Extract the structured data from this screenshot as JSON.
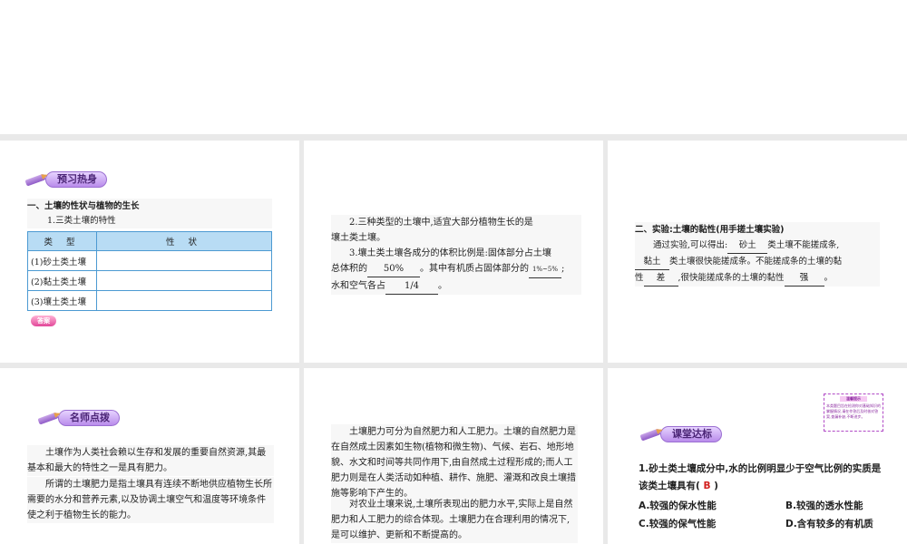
{
  "panel1": {
    "badge": "预习热身",
    "heading": "一、土壤的性状与植物的生长",
    "subheading": "1.三类土壤的特性",
    "table": {
      "headers": [
        "类 型",
        "性 状"
      ],
      "rows": [
        [
          "(1)砂土类土壤",
          ""
        ],
        [
          "(2)黏土类土壤",
          ""
        ],
        [
          "(3)壤土类土壤",
          ""
        ]
      ]
    },
    "answer_button": "答案"
  },
  "panel2": {
    "q2_line1": "2.三种类型的土壤中,适宜大部分植物生长的是",
    "q2_answer": "壤土类土壤",
    "q2_end": "。",
    "q3_line1": "3.壤土类土壤各成分的体积比例是:固体部分占土壤",
    "q3_pre": "总体积的",
    "q3_blank1": "50%",
    "q3_mid": "。其中有机质占固体部分的",
    "q3_blank2": "1%~5%",
    "q3_semicolon": ";",
    "q3_pre2": "水和空气各占",
    "q3_blank3": "1/4",
    "q3_end": "。"
  },
  "panel3": {
    "heading": "二、实验:土壤的黏性(用手搓土壤实验)",
    "s1": "通过实验,可以得出:",
    "b1": "砂土",
    "s2": "类土壤不能搓成条,",
    "b2": "黏土",
    "s3": "类土壤很快能搓成条。不能搓成条的土壤的黏",
    "s4": "性",
    "b3": "差",
    "s5": ",很快能搓成条的土壤的黏性",
    "b4": "强",
    "s6": "。"
  },
  "panel4": {
    "badge": "名师点拨",
    "p1": "土壤作为人类社会赖以生存和发展的重要自然资源,其最基本和最大的特性之一是具有肥力。",
    "p2": "所谓的土壤肥力是指土壤具有连续不断地供应植物生长所需要的水分和营养元素,以及协调土壤空气和温度等环境条件使之利于植物生长的能力。"
  },
  "panel5": {
    "p1": "土壤肥力可分为自然肥力和人工肥力。土壤的自然肥力是在自然成土因素如生物(植物和微生物)、气候、岩石、地形地貌、水文和时间等共同作用下,由自然成土过程形成的;而人工肥力则是在人类活动如种植、耕作、施肥、灌溉和改良土壤措施等影响下产生的。",
    "p2": "对农业土壤来说,土壤所表现出的肥力水平,实际上是自然肥力和人工肥力的综合体现。土壤肥力在合理利用的情况下,是可以维护、更新和不断提高的。"
  },
  "panel6": {
    "badge": "课堂达标",
    "tip_title": "温馨提示",
    "tip_body": "本类题目旨在检测你对基础知识的掌握情况,请在作答后及时核对答案,查漏补缺,不断进步。",
    "question": "1.砂土类土壤成分中,水的比例明显少于空气比例的实质是该类土壤具有(",
    "question_answer": "B",
    "question_end": ")",
    "options": {
      "A": "A.较强的保水性能",
      "B": "B.较强的透水性能",
      "C": "C.较强的保气性能",
      "D": "D.含有较多的有机质"
    }
  },
  "colors": {
    "background": "#e9e9e9",
    "table_border": "#4c9ad2",
    "table_header": "#b8dcf4",
    "badge": "#b98ceb",
    "answer_red": "#d2201e"
  }
}
